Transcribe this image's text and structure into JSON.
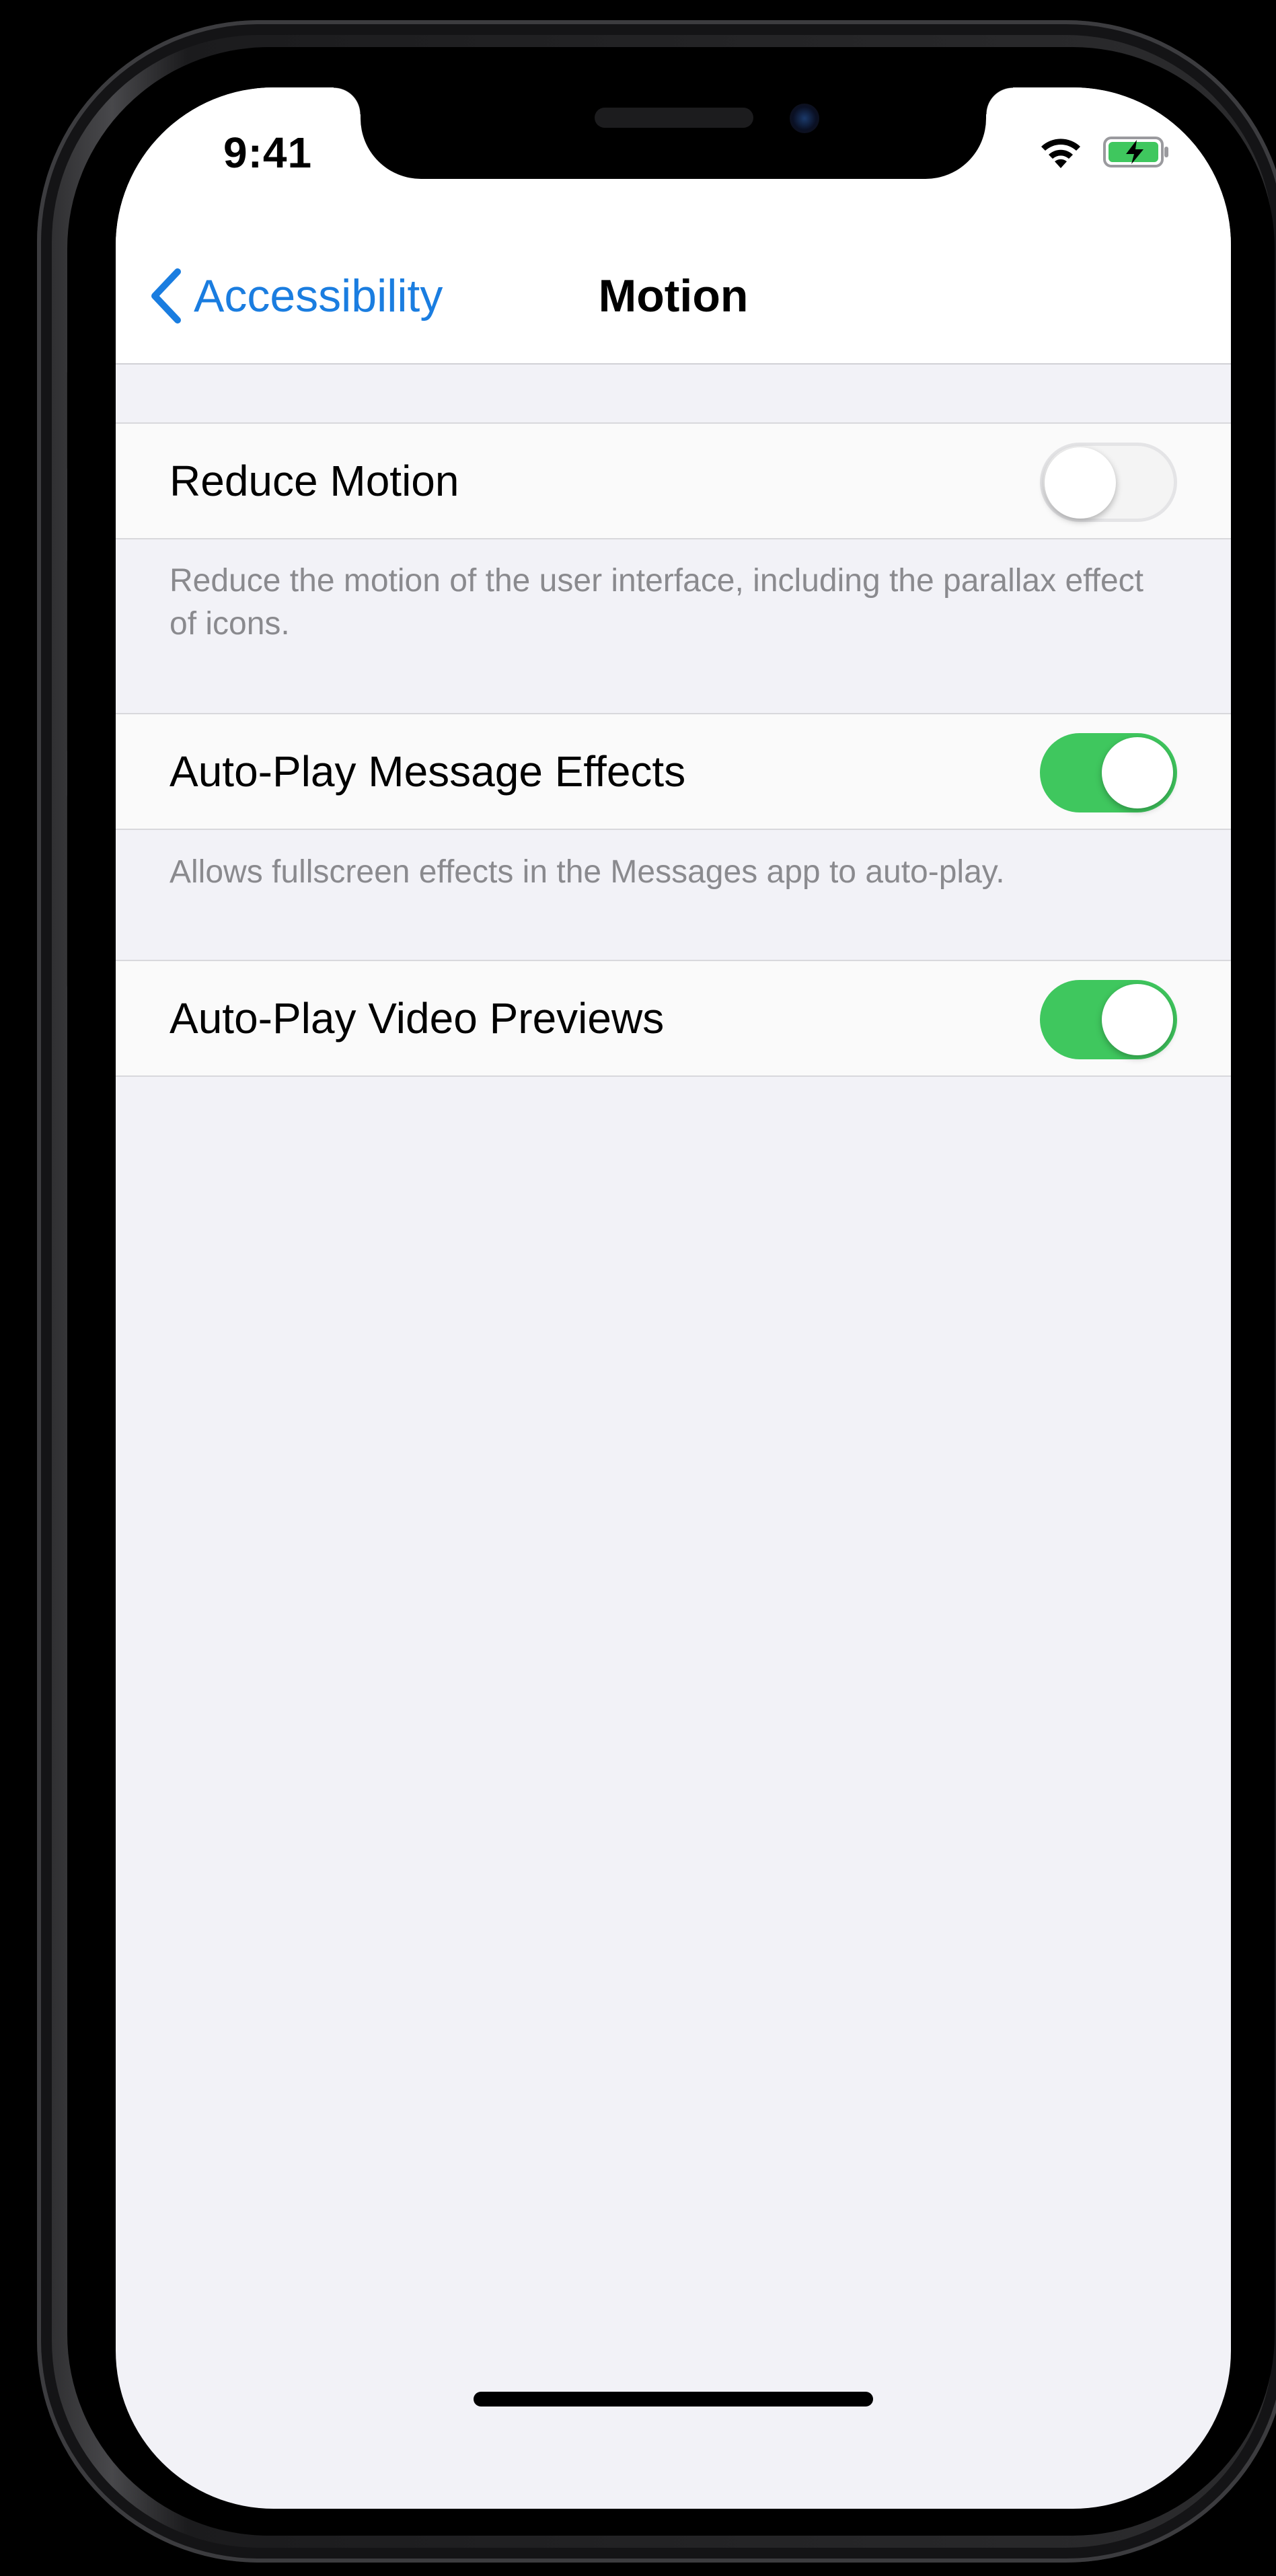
{
  "status_bar": {
    "time": "9:41",
    "wifi_icon": "wifi-icon",
    "battery_icon": "battery-charging-icon",
    "battery_color": "#3fc75e"
  },
  "nav": {
    "back_label": "Accessibility",
    "back_icon": "chevron-left-icon",
    "title": "Motion",
    "accent_color": "#1a7de0"
  },
  "settings": [
    {
      "label": "Reduce Motion",
      "enabled": false,
      "footer": "Reduce the motion of the user interface, including the parallax effect of icons."
    },
    {
      "label": "Auto-Play Message Effects",
      "enabled": true,
      "footer": "Allows fullscreen effects in the Messages app to auto-play."
    },
    {
      "label": "Auto-Play Video Previews",
      "enabled": true
    }
  ],
  "toggle_on_color": "#3fc75e"
}
